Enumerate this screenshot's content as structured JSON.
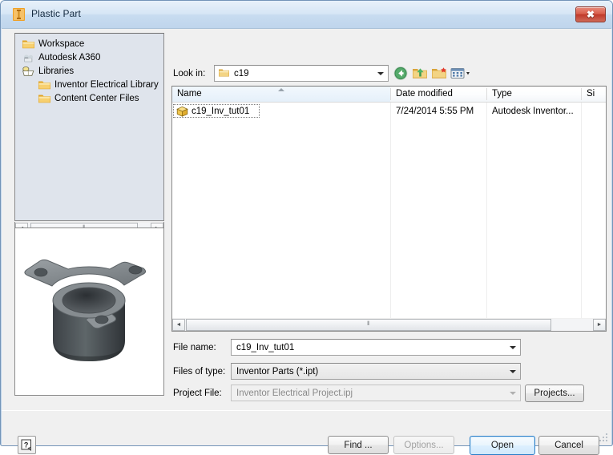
{
  "window": {
    "title": "Plastic Part",
    "title_icon": "inventor-part-icon",
    "close_label": "✖"
  },
  "sidebar": {
    "items": [
      {
        "label": "Workspace",
        "icon": "folder-icon",
        "indent": 0
      },
      {
        "label": "Autodesk A360",
        "icon": "cloud-folder-icon",
        "indent": 0
      },
      {
        "label": "Libraries",
        "icon": "library-icon",
        "indent": 0
      },
      {
        "label": "Inventor Electrical Library",
        "icon": "folder-icon",
        "indent": 1
      },
      {
        "label": "Content Center Files",
        "icon": "folder-icon",
        "indent": 1
      }
    ],
    "scrollbar": {
      "left_arrow": "◄",
      "right_arrow": "►",
      "grip": "⦀"
    }
  },
  "preview": {
    "name": "plastic-part-3d-preview",
    "alt": "3D preview of cylindrical flange with three mounting tabs"
  },
  "toolbar": {
    "look_in_label": "Look in:",
    "look_in_value": "c19",
    "look_in_icon": "folder-icon",
    "buttons": [
      {
        "name": "back-button",
        "icon": "back-arrow-icon"
      },
      {
        "name": "up-one-level-button",
        "icon": "up-folder-icon"
      },
      {
        "name": "new-folder-button",
        "icon": "new-folder-icon"
      },
      {
        "name": "views-button",
        "icon": "views-icon"
      }
    ]
  },
  "filelist": {
    "columns": [
      {
        "key": "name",
        "label": "Name",
        "sorted": true
      },
      {
        "key": "date",
        "label": "Date modified",
        "sorted": false
      },
      {
        "key": "type",
        "label": "Type",
        "sorted": false
      },
      {
        "key": "size",
        "label": "Si",
        "sorted": false
      }
    ],
    "rows": [
      {
        "name": "c19_Inv_tut01",
        "icon": "inventor-part-cube-icon",
        "date": "7/24/2014 5:55 PM",
        "type": "Autodesk Inventor...",
        "size": "",
        "selected": true
      }
    ],
    "scrollbar": {
      "left_arrow": "◄",
      "right_arrow": "►",
      "grip": "⦀"
    }
  },
  "form": {
    "file_name": {
      "label": "File name:",
      "value": "c19_Inv_tut01",
      "placeholder": ""
    },
    "files_of_type": {
      "label": "Files of type:",
      "value": "Inventor Parts (*.ipt)"
    },
    "project_file": {
      "label": "Project File:",
      "value": "Inventor Electrical Project.ipj",
      "disabled": true
    },
    "projects_button": "Projects..."
  },
  "footer": {
    "help_label": "?",
    "find_label": "Find ...",
    "options_label": "Options...",
    "open_label": "Open",
    "cancel_label": "Cancel"
  },
  "colors": {
    "accent": "#2a7fc9",
    "close_red": "#c0392a",
    "folder_yellow": "#f5c34a",
    "title_text": "#13293f"
  }
}
